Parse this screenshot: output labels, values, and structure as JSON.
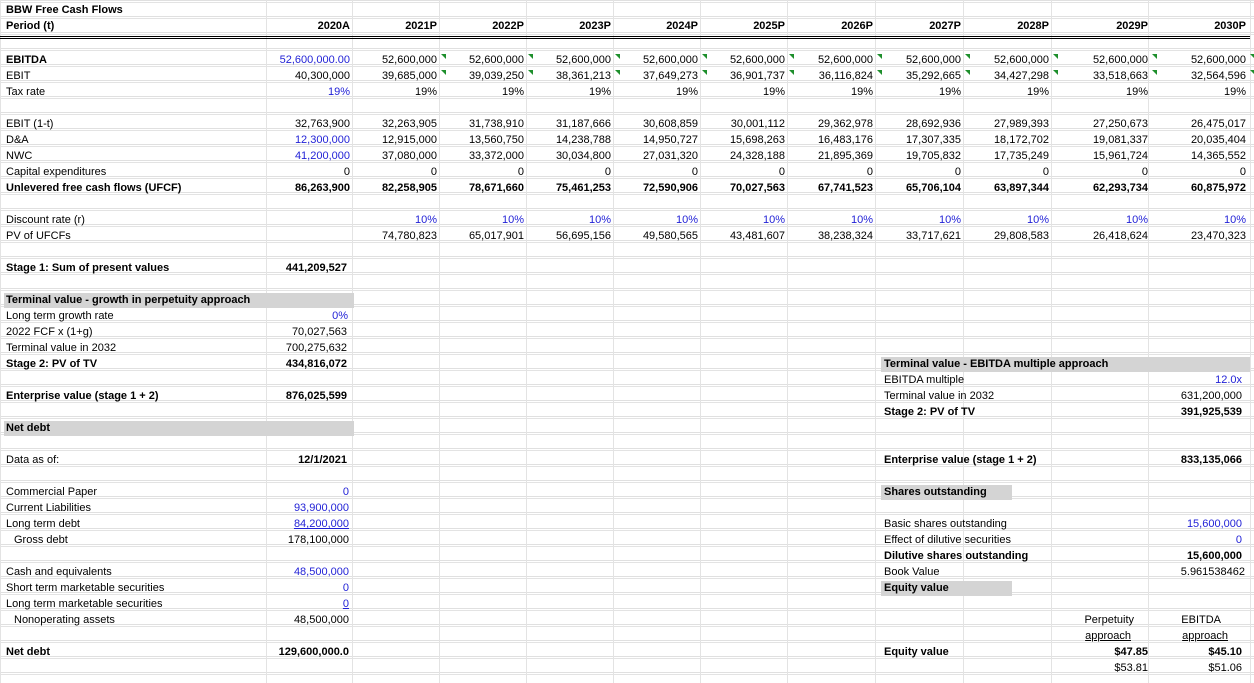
{
  "sheet_title": "BBW Free Cash Flows",
  "period_label": "Period (t)",
  "years": [
    "2020A",
    "2021P",
    "2022P",
    "2023P",
    "2024P",
    "2025P",
    "2026P",
    "2027P",
    "2028P",
    "2029P",
    "2030P"
  ],
  "rows": {
    "ebitda": {
      "label": "EBITDA",
      "values": [
        "52,600,000.00",
        "52,600,000",
        "52,600,000",
        "52,600,000",
        "52,600,000",
        "52,600,000",
        "52,600,000",
        "52,600,000",
        "52,600,000",
        "52,600,000",
        "52,600,000"
      ]
    },
    "ebit": {
      "label": "EBIT",
      "values": [
        "40,300,000",
        "39,685,000",
        "39,039,250",
        "38,361,213",
        "37,649,273",
        "36,901,737",
        "36,116,824",
        "35,292,665",
        "34,427,298",
        "33,518,663",
        "32,564,596"
      ]
    },
    "tax": {
      "label": "Tax rate",
      "values": [
        "19%",
        "19%",
        "19%",
        "19%",
        "19%",
        "19%",
        "19%",
        "19%",
        "19%",
        "19%",
        "19%"
      ]
    },
    "ebit1t": {
      "label": "EBIT (1-t)",
      "values": [
        "32,763,900",
        "32,263,905",
        "31,738,910",
        "31,187,666",
        "30,608,859",
        "30,001,112",
        "29,362,978",
        "28,692,936",
        "27,989,393",
        "27,250,673",
        "26,475,017"
      ]
    },
    "da": {
      "label": "D&A",
      "values": [
        "12,300,000",
        "12,915,000",
        "13,560,750",
        "14,238,788",
        "14,950,727",
        "15,698,263",
        "16,483,176",
        "17,307,335",
        "18,172,702",
        "19,081,337",
        "20,035,404"
      ]
    },
    "nwc": {
      "label": "NWC",
      "values": [
        "41,200,000",
        "37,080,000",
        "33,372,000",
        "30,034,800",
        "27,031,320",
        "24,328,188",
        "21,895,369",
        "19,705,832",
        "17,735,249",
        "15,961,724",
        "14,365,552"
      ]
    },
    "capex": {
      "label": "Capital expenditures",
      "values": [
        "0",
        "0",
        "0",
        "0",
        "0",
        "0",
        "0",
        "0",
        "0",
        "0",
        "0"
      ]
    },
    "ufcf": {
      "label": "Unlevered free cash flows (UFCF)",
      "values": [
        "86,263,900",
        "82,258,905",
        "78,671,660",
        "75,461,253",
        "72,590,906",
        "70,027,563",
        "67,741,523",
        "65,706,104",
        "63,897,344",
        "62,293,734",
        "60,875,972"
      ]
    },
    "disc": {
      "label": "Discount rate (r)",
      "values": [
        "",
        "10%",
        "10%",
        "10%",
        "10%",
        "10%",
        "10%",
        "10%",
        "10%",
        "10%",
        "10%"
      ]
    },
    "pv": {
      "label": "PV of UFCFs",
      "values": [
        "",
        "74,780,823",
        "65,017,901",
        "56,695,156",
        "49,580,565",
        "43,481,607",
        "38,238,324",
        "33,717,621",
        "29,808,583",
        "26,418,624",
        "23,470,323"
      ]
    }
  },
  "stage1": {
    "label": "Stage 1: Sum of present values",
    "value": "441,209,527"
  },
  "tv_perp": {
    "header": "Terminal value - growth in perpetuity approach",
    "growth_label": "Long term growth rate",
    "growth_value": "0%",
    "fcf_label": "2022 FCF x (1+g)",
    "fcf_value": "70,027,563",
    "tv_label": "Terminal value in 2032",
    "tv_value": "700,275,632",
    "pv_label": "Stage 2: PV of TV",
    "pv_value": "434,816,072"
  },
  "ev_perp": {
    "label": "Enterprise value (stage 1 + 2)",
    "value": "876,025,599"
  },
  "net_debt_header": "Net debt",
  "data_as_of": {
    "label": "Data as of:",
    "value": "12/1/2021"
  },
  "debt": {
    "cp_label": "Commercial Paper",
    "cp_value": "0",
    "cl_label": "Current Liabilities",
    "cl_value": "93,900,000",
    "ltd_label": "Long term debt",
    "ltd_value": "84,200,000",
    "gross_label": "Gross debt",
    "gross_value": "178,100,000"
  },
  "cash": {
    "cash_label": "Cash and equivalents",
    "cash_value": "48,500,000",
    "stms_label": "Short term marketable securities",
    "stms_value": "0",
    "ltms_label": "Long term marketable securities",
    "ltms_value": "0",
    "nonop_label": "Nonoperating assets",
    "nonop_value": "48,500,000"
  },
  "net_debt": {
    "label": "Net debt",
    "value": "129,600,000.0"
  },
  "tv_ebitda": {
    "header": "Terminal value - EBITDA multiple approach",
    "mult_label": "EBITDA multiple",
    "mult_value": "12.0x",
    "tv_label": "Terminal value in 2032",
    "tv_value": "631,200,000",
    "pv_label": "Stage 2: PV of TV",
    "pv_value": "391,925,539"
  },
  "ev_ebitda": {
    "label": "Enterprise value (stage 1 + 2)",
    "value": "833,135,066"
  },
  "shares": {
    "header": "Shares outstanding",
    "basic_label": "Basic shares outstanding",
    "basic_value": "15,600,000",
    "dil_eff_label": "Effect of dilutive securities",
    "dil_eff_value": "0",
    "dil_label": "Dilutive shares outstanding",
    "dil_value": "15,600,000",
    "book_label": "Book Value",
    "book_value": "5.961538462",
    "equity_label": "Equity value"
  },
  "equity": {
    "perp_h1": "Perpetuity",
    "perp_h2": "approach",
    "ebitda_h1": "EBITDA",
    "ebitda_h2": "approach",
    "label": "Equity value",
    "perp_v1": "$47.85",
    "perp_v2": "$53.81",
    "ebitda_v1": "$45.10",
    "ebitda_v2": "$51.06"
  },
  "colors": {
    "input_blue": "#1f1fd6",
    "header_gray": "#d4d4d4",
    "gridline": "#e3e3e3",
    "error_flag": "#1e8f2c"
  }
}
